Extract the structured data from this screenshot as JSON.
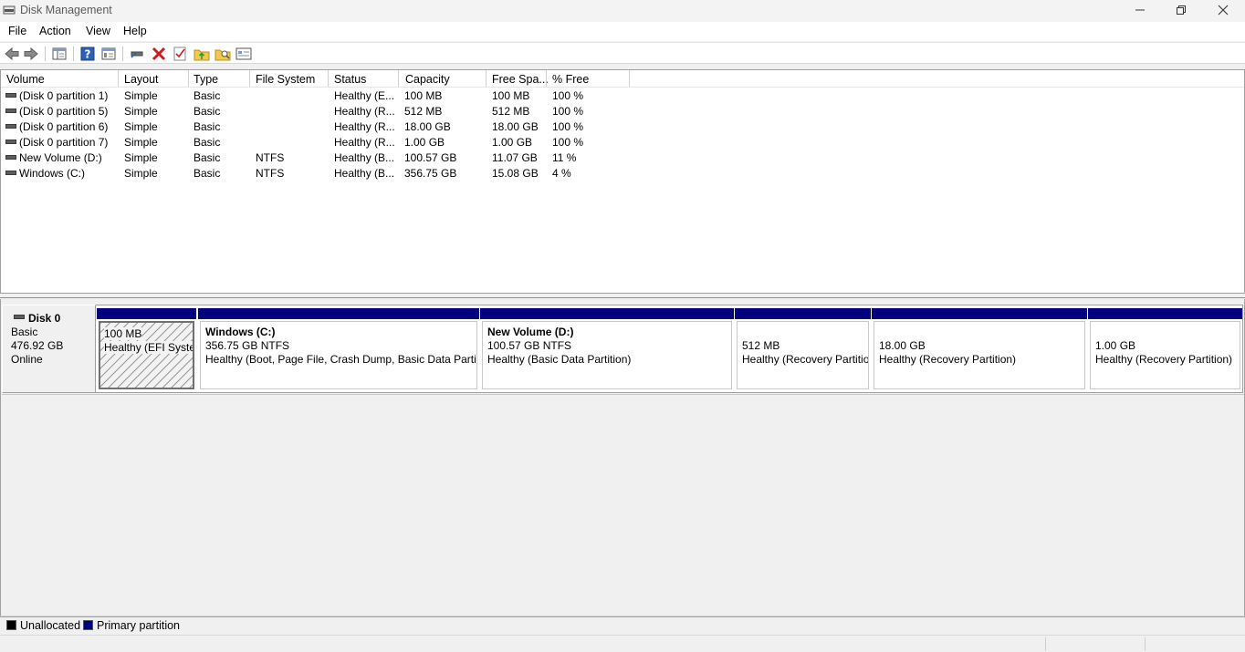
{
  "window": {
    "title": "Disk Management",
    "icon": "disk-management-icon"
  },
  "menu": {
    "file": "File",
    "action": "Action",
    "view": "View",
    "help": "Help"
  },
  "toolbar": {
    "icons": [
      "back-arrow-icon",
      "forward-arrow-icon",
      "show-hide-console-tree-icon",
      "help-icon",
      "properties-icon",
      "connect-disk-icon",
      "delete-icon",
      "check-icon",
      "rescan-icon",
      "explore-icon",
      "settings-icon"
    ]
  },
  "volume_list": {
    "columns": [
      "Volume",
      "Layout",
      "Type",
      "File System",
      "Status",
      "Capacity",
      "Free Spa...",
      "% Free"
    ],
    "rows": [
      {
        "volume": "(Disk 0 partition 1)",
        "layout": "Simple",
        "type": "Basic",
        "fs": "",
        "status": "Healthy (E...",
        "capacity": "100 MB",
        "free": "100 MB",
        "pct": "100 %"
      },
      {
        "volume": "(Disk 0 partition 5)",
        "layout": "Simple",
        "type": "Basic",
        "fs": "",
        "status": "Healthy (R...",
        "capacity": "512 MB",
        "free": "512 MB",
        "pct": "100 %"
      },
      {
        "volume": "(Disk 0 partition 6)",
        "layout": "Simple",
        "type": "Basic",
        "fs": "",
        "status": "Healthy (R...",
        "capacity": "18.00 GB",
        "free": "18.00 GB",
        "pct": "100 %"
      },
      {
        "volume": "(Disk 0 partition 7)",
        "layout": "Simple",
        "type": "Basic",
        "fs": "",
        "status": "Healthy (R...",
        "capacity": "1.00 GB",
        "free": "1.00 GB",
        "pct": "100 %"
      },
      {
        "volume": "New Volume (D:)",
        "layout": "Simple",
        "type": "Basic",
        "fs": "NTFS",
        "status": "Healthy (B...",
        "capacity": "100.57 GB",
        "free": "11.07 GB",
        "pct": "11 %"
      },
      {
        "volume": "Windows (C:)",
        "layout": "Simple",
        "type": "Basic",
        "fs": "NTFS",
        "status": "Healthy (B...",
        "capacity": "356.75 GB",
        "free": "15.08 GB",
        "pct": "4 %"
      }
    ]
  },
  "disk": {
    "name": "Disk 0",
    "type": "Basic",
    "size": "476.92 GB",
    "state": "Online",
    "partitions": [
      {
        "name": "",
        "size": "100 MB",
        "status": "Healthy (EFI System Partition)"
      },
      {
        "name": "Windows  (C:)",
        "size": "356.75 GB NTFS",
        "status": "Healthy (Boot, Page File, Crash Dump, Basic Data Partition)"
      },
      {
        "name": "New Volume  (D:)",
        "size": "100.57 GB NTFS",
        "status": "Healthy (Basic Data Partition)"
      },
      {
        "name": "",
        "size": "512 MB",
        "status": "Healthy (Recovery Partition)"
      },
      {
        "name": "",
        "size": "18.00 GB",
        "status": "Healthy (Recovery Partition)"
      },
      {
        "name": "",
        "size": "1.00 GB",
        "status": "Healthy (Recovery Partition)"
      }
    ]
  },
  "legend": {
    "unallocated": "Unallocated",
    "primary": "Primary partition",
    "unallocated_color": "#000000",
    "primary_color": "#00007f"
  }
}
